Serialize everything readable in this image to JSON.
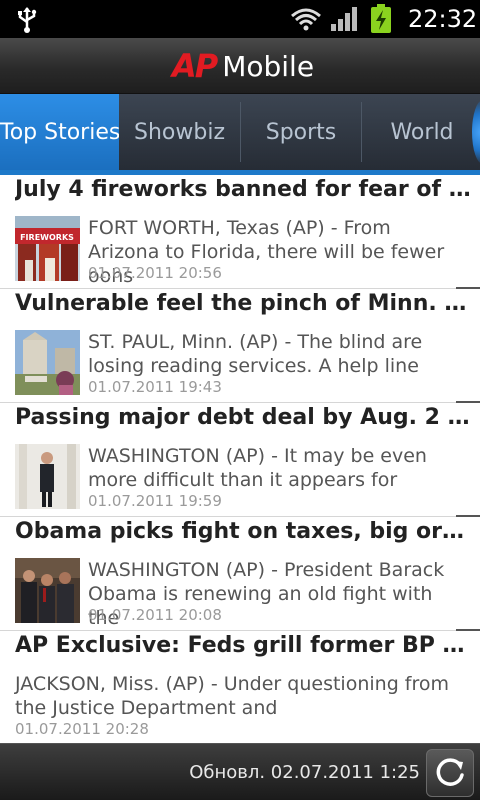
{
  "status_bar": {
    "time": "22:32",
    "icons": [
      "usb-icon",
      "wifi-icon",
      "signal-icon",
      "battery-charging-icon"
    ]
  },
  "app": {
    "logo_mark": "AP",
    "logo_text": "Mobile"
  },
  "tabs": [
    {
      "label": "Top Stories",
      "active": true
    },
    {
      "label": "Showbiz",
      "active": false
    },
    {
      "label": "Sports",
      "active": false
    },
    {
      "label": "World",
      "active": false
    }
  ],
  "news": [
    {
      "title": "July 4 fireworks banned for fear of wi...",
      "description": "FORT WORTH, Texas (AP) - From Arizona to Florida, there will be fewer oohs",
      "date": "01.07.2011 20:56",
      "has_image": true,
      "thumb_text": "FIREWORKS"
    },
    {
      "title": "Vulnerable feel the pinch of Minn. go...",
      "description": "ST. PAUL, Minn. (AP) - The blind are losing reading services. A help line",
      "date": "01.07.2011 19:43",
      "has_image": true
    },
    {
      "title": "Passing major debt deal by Aug. 2 se...",
      "description": "WASHINGTON (AP) - It may be even more difficult than it appears for",
      "date": "01.07.2011 19:59",
      "has_image": true
    },
    {
      "title": "Obama picks fight on taxes, big or ju...",
      "description": "WASHINGTON (AP) - President Barack Obama is renewing an old fight with the",
      "date": "01.07.2011 20:08",
      "has_image": true
    },
    {
      "title": "AP Exclusive: Feds grill former BP chi...",
      "description": "JACKSON, Miss. (AP) - Under questioning from the Justice Department and",
      "date": "01.07.2011 20:28",
      "has_image": false
    }
  ],
  "bottom_bar": {
    "updated_text": "Обновл. 02.07.2011 1:25",
    "refresh_icon": "refresh-icon"
  },
  "colors": {
    "accent_blue": "#1d79c9",
    "ap_red": "#e21b22"
  }
}
